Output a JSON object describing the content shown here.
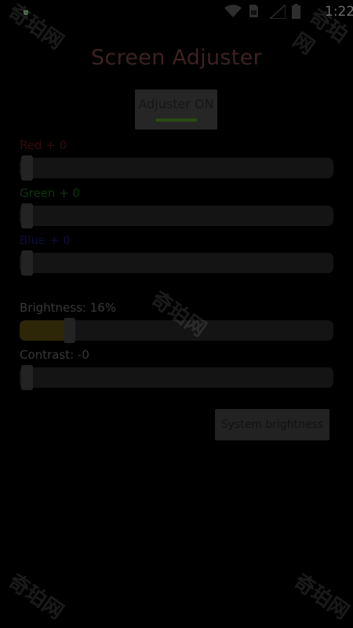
{
  "status_bar": {
    "time": "1:22",
    "icons": [
      "wifi-icon",
      "sim-card-icon",
      "signal-icon",
      "battery-icon"
    ]
  },
  "app": {
    "title": "Screen Adjuster"
  },
  "toggle": {
    "label": "Adjuster ON",
    "state": "on",
    "indicator_color": "#2c4a12"
  },
  "sliders": {
    "red": {
      "label": "Red + 0",
      "value": 0,
      "color": "#350b0b"
    },
    "green": {
      "label": "Green + 0",
      "value": 0,
      "color": "#0f350f"
    },
    "blue": {
      "label": "Blue + 0",
      "value": 0,
      "color": "#0c0c3a"
    },
    "brightness": {
      "label": "Brightness: 16%",
      "value": 0.16,
      "color": "#2d2708"
    },
    "contrast": {
      "label": "Contrast: -0",
      "value": 0
    }
  },
  "buttons": {
    "system_brightness": "System brightness"
  },
  "watermark": "奇珀网"
}
